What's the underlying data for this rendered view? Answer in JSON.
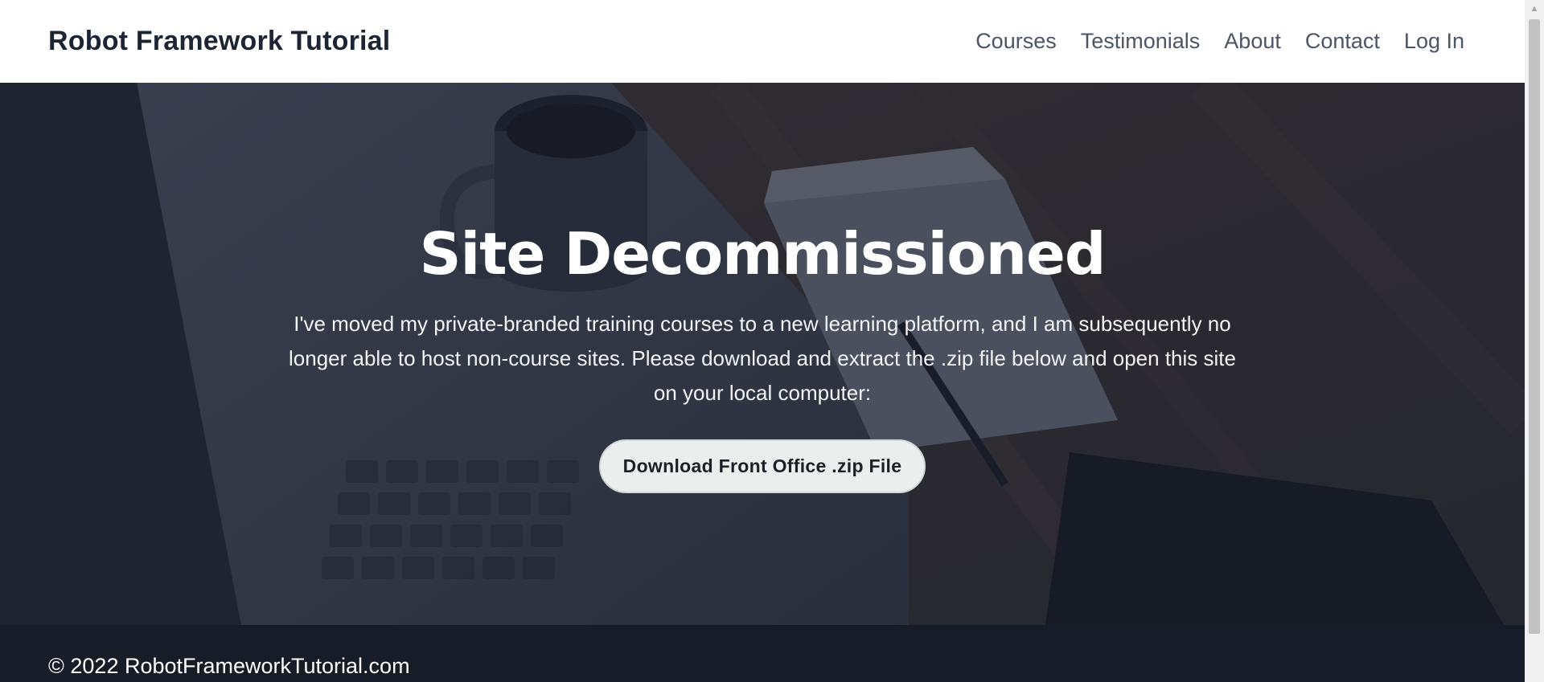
{
  "header": {
    "brand": "Robot Framework Tutorial",
    "nav": [
      {
        "label": "Courses"
      },
      {
        "label": "Testimonials"
      },
      {
        "label": "About"
      },
      {
        "label": "Contact"
      },
      {
        "label": "Log In"
      }
    ]
  },
  "hero": {
    "title": "Site Decommissioned",
    "text": "I've moved my private-branded training courses to a new learning platform, and I am subsequently no longer able to host non-course sites. Please download and extract the .zip file below and open this site on your local computer:",
    "button_label": "Download Front Office .zip File",
    "background_image": "desk-laptop-coffee-photo"
  },
  "footer": {
    "copyright": "© 2022 RobotFrameworkTutorial.com"
  },
  "colors": {
    "header_bg": "#ffffff",
    "brand_text": "#1d2433",
    "nav_text": "#4b5566",
    "hero_overlay": "#1a1f2e",
    "button_bg": "#eceeee",
    "footer_bg": "#171c29"
  }
}
